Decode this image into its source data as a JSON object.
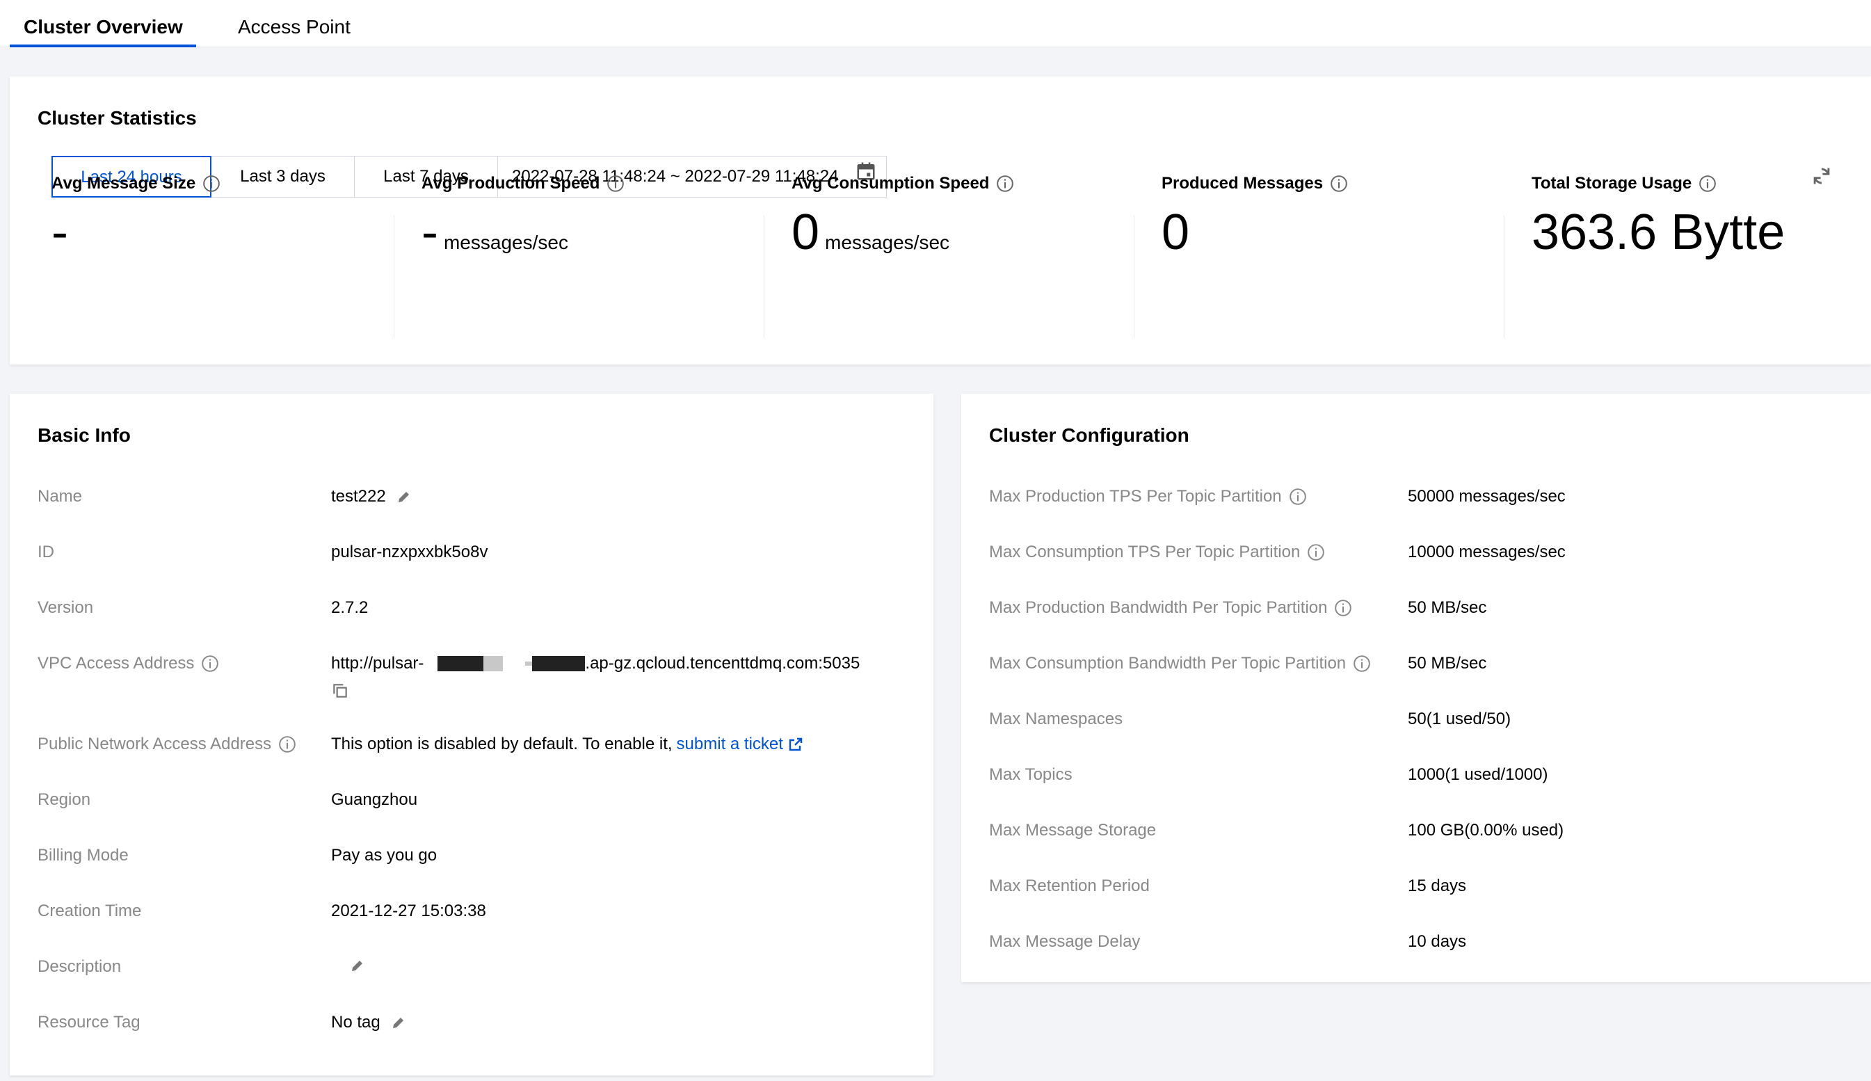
{
  "tabs": [
    {
      "label": "Cluster Overview",
      "active": true
    },
    {
      "label": "Access Point",
      "active": false
    }
  ],
  "statistics": {
    "title": "Cluster Statistics",
    "ranges": [
      "Last 24 hours",
      "Last 3 days",
      "Last 7 days"
    ],
    "selected_range": "Last 24 hours",
    "date_range": "2022-07-28 11:48:24 ~ 2022-07-29 11:48:24",
    "metrics": [
      {
        "label": "Avg Message Size",
        "value": "-",
        "unit": ""
      },
      {
        "label": "Avg Production Speed",
        "value": "-",
        "unit": "messages/sec"
      },
      {
        "label": "Avg Consumption Speed",
        "value": "0",
        "unit": "messages/sec"
      },
      {
        "label": "Produced Messages",
        "value": "0",
        "unit": ""
      },
      {
        "label": "Total Storage Usage",
        "value": "363.6 Bytte",
        "unit": ""
      }
    ]
  },
  "basic_info": {
    "title": "Basic Info",
    "rows": [
      {
        "label": "Name",
        "value": "test222"
      },
      {
        "label": "ID",
        "value": "pulsar-nzxpxxbk5o8v"
      },
      {
        "label": "Version",
        "value": "2.7.2"
      },
      {
        "label": "VPC Access Address",
        "value_prefix": "http://pulsar-",
        "value_suffix": ".ap-gz.qcloud.tencenttdmq.com:5035"
      },
      {
        "label": "Public Network Access Address",
        "value": "This option is disabled by default. To enable it,",
        "link": "submit a ticket"
      },
      {
        "label": "Region",
        "value": "Guangzhou"
      },
      {
        "label": "Billing Mode",
        "value": "Pay as you go"
      },
      {
        "label": "Creation Time",
        "value": "2021-12-27 15:03:38"
      },
      {
        "label": "Description",
        "value": ""
      },
      {
        "label": "Resource Tag",
        "value": "No tag"
      }
    ]
  },
  "cluster_config": {
    "title": "Cluster Configuration",
    "rows": [
      {
        "label": "Max Production TPS Per Topic Partition",
        "value": "50000 messages/sec"
      },
      {
        "label": "Max Consumption TPS Per Topic Partition",
        "value": "10000 messages/sec"
      },
      {
        "label": "Max Production Bandwidth Per Topic Partition",
        "value": "50 MB/sec"
      },
      {
        "label": "Max Consumption Bandwidth Per Topic Partition",
        "value": "50 MB/sec"
      },
      {
        "label": "Max Namespaces",
        "value": "50(1 used/50)"
      },
      {
        "label": "Max Topics",
        "value": "1000(1 used/1000)"
      },
      {
        "label": "Max Message Storage",
        "value": "100 GB(0.00% used)"
      },
      {
        "label": "Max Retention Period",
        "value": "15 days"
      },
      {
        "label": "Max Message Delay",
        "value": "10 days"
      }
    ]
  },
  "colors": {
    "accent": "#0052d9",
    "label_grey": "#888888",
    "background": "#f3f4f7"
  }
}
